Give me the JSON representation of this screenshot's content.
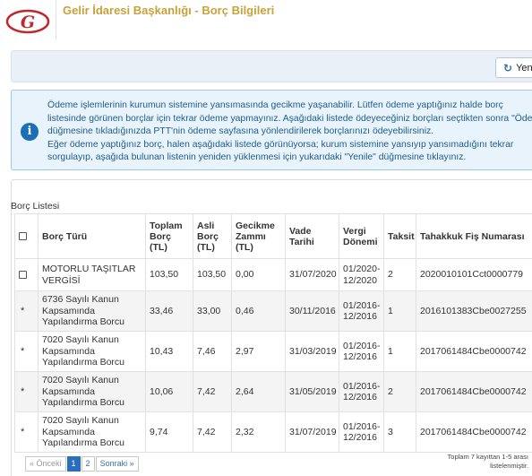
{
  "header": {
    "title": "Gelir İdaresi Başkanlığı - Borç Bilgileri",
    "logo_letter": "G"
  },
  "toolbar": {
    "refresh_label": "Yenile"
  },
  "info": {
    "lines": [
      "Ödeme işlemlerinin kurumun sistemine yansımasında gecikme yaşanabilir. Lütfen ödeme yaptığınız halde borç",
      "listesinde görünen borçlar için tekrar ödeme yapmayınız. Aşağıdaki listede ödeyeceğiniz borçları seçtikten sonra \"Öde\"",
      "düğmesine tıkladığınızda PTT'nin ödeme sayfasına yönlendirilerek borçlarınızı ödeyebilirsiniz.",
      "Eğer ödeme yaptığınız borç, halen aşağıdaki listede görünüyorsa; kurum sistemine yansıyıp yansımadığını tekrar",
      "sorgulayıp, aşağıda bulunan listenin yeniden yüklenmesi için yukarıdaki \"Yenile\" düğmesine tıklayınız."
    ]
  },
  "list": {
    "title": "Borç Listesi",
    "columns": [
      "Borç Türü",
      "Toplam Borç (TL)",
      "Asli Borç (TL)",
      "Gecikme Zammı (TL)",
      "Vade Tarihi",
      "Vergi Dönemi",
      "Taksit",
      "Tahakkuk Fiş Numarası"
    ],
    "rows": [
      {
        "mark": "checkbox",
        "type": "MOTORLU TAŞITLAR VERGİSİ",
        "total": "103,50",
        "principal": "103,50",
        "penalty": "0,00",
        "due": "31/07/2020",
        "period": "01/2020-12/2020",
        "installment": "2",
        "slip": "2020010101Cct0000779"
      },
      {
        "mark": "*",
        "type": "6736 Sayılı Kanun Kapsamında Yapılandırma Borcu",
        "total": "33,46",
        "principal": "33,00",
        "penalty": "0,46",
        "due": "30/11/2016",
        "period": "01/2016-12/2016",
        "installment": "1",
        "slip": "2016101383Cbe0027255"
      },
      {
        "mark": "*",
        "type": "7020 Sayılı Kanun Kapsamında Yapılandırma Borcu",
        "total": "10,43",
        "principal": "7,46",
        "penalty": "2,97",
        "due": "31/03/2019",
        "period": "01/2016-12/2016",
        "installment": "1",
        "slip": "2017061484Cbe0000742"
      },
      {
        "mark": "*",
        "type": "7020 Sayılı Kanun Kapsamında Yapılandırma Borcu",
        "total": "10,06",
        "principal": "7,42",
        "penalty": "2,64",
        "due": "31/05/2019",
        "period": "01/2016-12/2016",
        "installment": "2",
        "slip": "2017061484Cbe0000742"
      },
      {
        "mark": "*",
        "type": "7020 Sayılı Kanun Kapsamında Yapılandırma Borcu",
        "total": "9,74",
        "principal": "7,42",
        "penalty": "2,32",
        "due": "31/07/2019",
        "period": "01/2016-12/2016",
        "installment": "3",
        "slip": "2017061484Cbe0000742"
      }
    ]
  },
  "pagination": {
    "prev": "« Önceki",
    "pages": [
      "1",
      "2"
    ],
    "active": "1",
    "next": "Sonraki »"
  },
  "summary": "Toplam 7 kayıttan 1-5 arası listelenmiştir.",
  "colors": {
    "title": "#c8a13a",
    "logo": "#c0282d",
    "info_text": "#1d5d8e",
    "active_page": "#2a6ebb"
  }
}
